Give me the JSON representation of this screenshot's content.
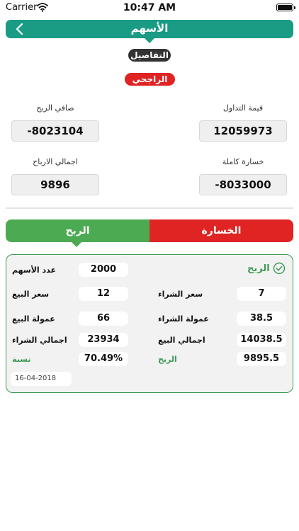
{
  "status_bar": {
    "carrier": "Carrier",
    "time": "10:47 AM"
  },
  "header": {
    "title": "الأسهم",
    "details_label": "التفاصيل",
    "bank_label": "الراجحي"
  },
  "summary": {
    "net_profit": {
      "label": "صافي الربح",
      "value": "-8023104"
    },
    "trade_value": {
      "label": "قيمة التداول",
      "value": "12059973"
    },
    "total_profits": {
      "label": "اجمالي الارباح",
      "value": "9896"
    },
    "total_loss": {
      "label": "خسارة كاملة",
      "value": "-8033000"
    }
  },
  "segments": {
    "profit": "الربح",
    "loss": "الخسارة"
  },
  "result": {
    "title": "الربح",
    "shares_label": "عدد الأسهم",
    "shares_value": "2000",
    "sell_price_label": "سعر البيع",
    "sell_price_value": "12",
    "buy_price_label": "سعر الشراء",
    "buy_price_value": "7",
    "sell_commission_label": "عمولة البيع",
    "sell_commission_value": "66",
    "buy_commission_label": "عمولة الشراء",
    "buy_commission_value": "38.5",
    "total_buy_label": "اجمالي الشراء",
    "total_buy_value": "23934",
    "total_sell_label": "اجمالي البيع",
    "total_sell_value": "14038.5",
    "ratio_label": "نسبة",
    "ratio_value": "70.49%",
    "profit_label": "الربح",
    "profit_value": "9895.5",
    "date": "16-04-2018"
  },
  "colors": {
    "header": "#1a9b84",
    "profit": "#4caa52",
    "loss": "#e02424",
    "details_pill": "#333333"
  },
  "icons": {
    "back": "chevron-left-icon",
    "check": "check-circle-icon",
    "wifi": "wifi-icon",
    "battery": "battery-icon"
  }
}
